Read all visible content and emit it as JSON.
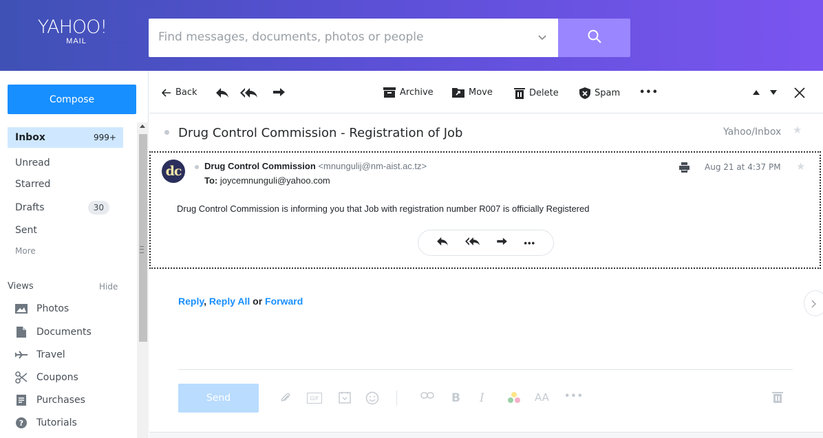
{
  "header": {
    "logo_line1": "YAHOO!",
    "logo_line2": "MAIL",
    "search_placeholder": "Find messages, documents, photos or people",
    "gradient_start": "#3f51b5",
    "gradient_end": "#7b55f0",
    "search_button_color": "#9a86ff"
  },
  "sidebar": {
    "compose_label": "Compose",
    "folders": [
      {
        "label": "Inbox",
        "count": "999+"
      },
      {
        "label": "Unread"
      },
      {
        "label": "Starred"
      },
      {
        "label": "Drafts",
        "count": "30"
      },
      {
        "label": "Sent"
      },
      {
        "label": "More"
      }
    ],
    "views_title": "Views",
    "views_hide": "Hide",
    "views": [
      {
        "label": "Photos",
        "icon": "photos-icon"
      },
      {
        "label": "Documents",
        "icon": "documents-icon"
      },
      {
        "label": "Travel",
        "icon": "travel-icon"
      },
      {
        "label": "Coupons",
        "icon": "coupons-icon"
      },
      {
        "label": "Purchases",
        "icon": "purchases-icon"
      },
      {
        "label": "Tutorials",
        "icon": "tutorials-icon"
      }
    ]
  },
  "toolbar": {
    "back": "Back",
    "archive": "Archive",
    "move": "Move",
    "delete": "Delete",
    "spam": "Spam",
    "more": "•••"
  },
  "email": {
    "subject": "Drug Control Commission - Registration of Job",
    "folder_path": "Yahoo/Inbox",
    "avatar_initials": "dc",
    "sender_name": "Drug Control Commission",
    "sender_address": "<mnungulij@nm-aist.ac.tz>",
    "to_label": "To:",
    "to_address": "joycemnunguli@yahoo.com",
    "date": "Aug 21 at 4:37 PM",
    "body": "Drug Control Commission is informing you that Job with registration number R007 is officially Registered",
    "more": "•••"
  },
  "reply": {
    "reply": "Reply",
    "comma": ",",
    "reply_all": "Reply All",
    "or1": "or",
    "forward": "Forward"
  },
  "composer": {
    "send": "Send",
    "gif": "GIF",
    "bold": "B",
    "italic": "I",
    "font_size": "AA",
    "more": "•••"
  },
  "colors": {
    "accent": "#188fff",
    "inbox_active": "#cfe8ff",
    "send_disabled": "#b9dcff"
  }
}
